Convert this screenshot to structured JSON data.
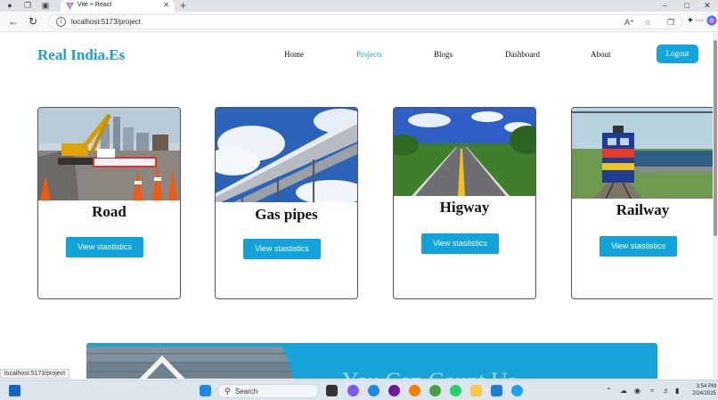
{
  "browser": {
    "tab_title": "Vite + React",
    "url": "localhost:5173/project",
    "status_url": "localhost:5173/project"
  },
  "site": {
    "logo": "Real India.Es",
    "nav": [
      "Home",
      "Projects",
      "Blogs",
      "Dashboard",
      "About"
    ],
    "active_nav": "Projects",
    "logout": "Logout"
  },
  "cards": [
    {
      "title": "Road",
      "button": "View stastistics",
      "image": "road-construction-photo"
    },
    {
      "title": "Gas pipes",
      "button": "View stastistics",
      "image": "gas-pipeline-photo"
    },
    {
      "title": "Higway",
      "button": "View stastistics",
      "image": "highway-photo"
    },
    {
      "title": "Railway",
      "button": "View stastistics",
      "image": "train-photo"
    }
  ],
  "banner": {
    "text": "You Can Count Us"
  },
  "taskbar": {
    "search_placeholder": "Search",
    "time": "3:54 PM",
    "date": "2/24/2025"
  },
  "colors": {
    "accent": "#14a4dc",
    "logo": "#1a9fd0",
    "active_nav": "#1aa6d8"
  }
}
